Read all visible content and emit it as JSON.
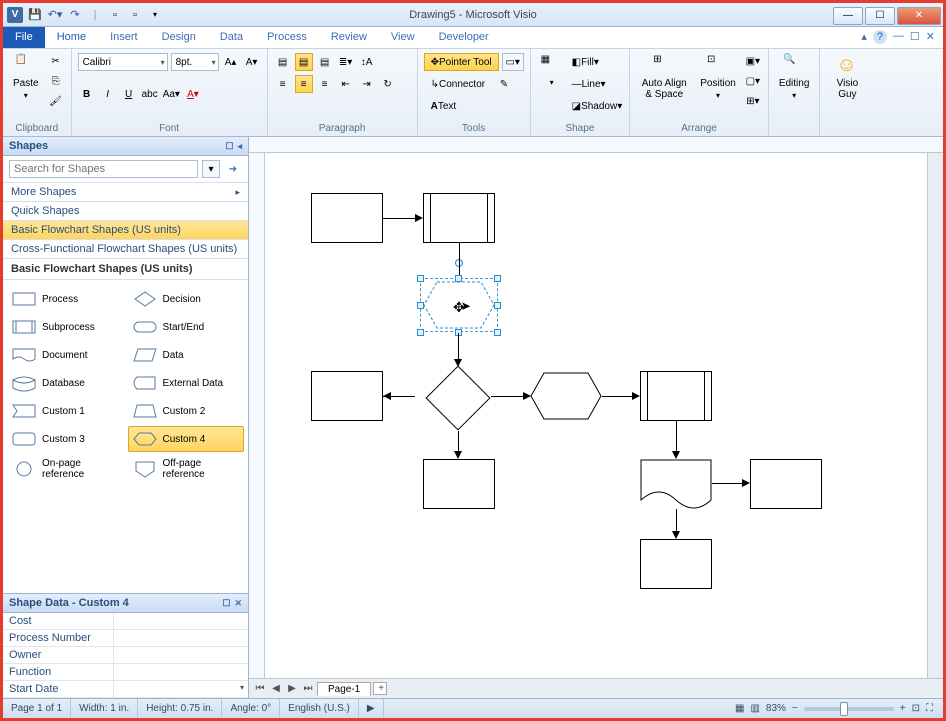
{
  "app": {
    "title": "Drawing5 - Microsoft Visio"
  },
  "qat": {
    "save": "💾",
    "undo": "↶",
    "redo": "↷"
  },
  "menu": {
    "file": "File",
    "home": "Home",
    "insert": "Insert",
    "design": "Design",
    "data": "Data",
    "process": "Process",
    "review": "Review",
    "view": "View",
    "developer": "Developer"
  },
  "ribbon": {
    "clipboard": {
      "paste": "Paste",
      "label": "Clipboard"
    },
    "font": {
      "font_name": "Calibri",
      "font_size": "8pt.",
      "label": "Font"
    },
    "paragraph": {
      "label": "Paragraph"
    },
    "tools": {
      "pointer": "Pointer Tool",
      "connector": "Connector",
      "text": "Text",
      "label": "Tools"
    },
    "shape": {
      "fill": "Fill",
      "line": "Line",
      "shadow": "Shadow",
      "label": "Shape"
    },
    "arrange": {
      "align": "Auto Align & Space",
      "position": "Position",
      "label": "Arrange"
    },
    "editing": {
      "label": "Editing"
    },
    "visioguy": {
      "label": "Visio Guy"
    }
  },
  "shapes_panel": {
    "title": "Shapes",
    "search_placeholder": "Search for Shapes",
    "more": "More Shapes",
    "quick": "Quick Shapes",
    "basic_us": "Basic Flowchart Shapes (US units)",
    "cross_us": "Cross-Functional Flowchart Shapes (US units)",
    "header": "Basic Flowchart Shapes (US units)",
    "shapes": {
      "process": "Process",
      "decision": "Decision",
      "subprocess": "Subprocess",
      "startend": "Start/End",
      "document": "Document",
      "data": "Data",
      "database": "Database",
      "external": "External Data",
      "custom1": "Custom 1",
      "custom2": "Custom 2",
      "custom3": "Custom 3",
      "custom4": "Custom 4",
      "onpage": "On-page reference",
      "offpage": "Off-page reference"
    }
  },
  "shapedata": {
    "title": "Shape Data - Custom 4",
    "rows": {
      "cost": "Cost",
      "process_number": "Process Number",
      "owner": "Owner",
      "function": "Function",
      "start_date": "Start Date"
    }
  },
  "page_tabs": {
    "page1": "Page-1"
  },
  "status": {
    "page": "Page 1 of 1",
    "width": "Width: 1 in.",
    "height": "Height: 0.75 in.",
    "angle": "Angle: 0°",
    "lang": "English (U.S.)",
    "zoom": "83%"
  }
}
